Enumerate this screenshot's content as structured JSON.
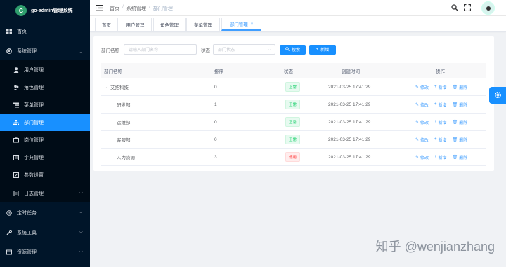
{
  "app": {
    "title": "go-admin管理系统",
    "logo_letter": "G"
  },
  "sidebar": {
    "items": [
      {
        "label": "首页",
        "icon": "dashboard-icon",
        "level": "top"
      },
      {
        "label": "系统管理",
        "icon": "setting-icon",
        "level": "top",
        "expanded": true
      },
      {
        "label": "用户管理",
        "icon": "user-icon",
        "level": "sub"
      },
      {
        "label": "角色管理",
        "icon": "peoples-icon",
        "level": "sub"
      },
      {
        "label": "菜单管理",
        "icon": "tree-table-icon",
        "level": "sub"
      },
      {
        "label": "部门管理",
        "icon": "tree-icon",
        "level": "sub",
        "active": true
      },
      {
        "label": "岗位管理",
        "icon": "post-icon",
        "level": "sub"
      },
      {
        "label": "字典管理",
        "icon": "dict-icon",
        "level": "sub"
      },
      {
        "label": "参数设置",
        "icon": "edit-icon",
        "level": "sub"
      },
      {
        "label": "日志管理",
        "icon": "log-icon",
        "level": "sub"
      },
      {
        "label": "定时任务",
        "icon": "job-icon",
        "level": "top"
      },
      {
        "label": "系统工具",
        "icon": "tool-icon",
        "level": "top"
      },
      {
        "label": "资源管理",
        "icon": "resource-icon",
        "level": "top"
      }
    ]
  },
  "header": {
    "breadcrumb": [
      "首页",
      "系统管理",
      "部门管理"
    ]
  },
  "tabs": [
    {
      "label": "首页"
    },
    {
      "label": "用户管理"
    },
    {
      "label": "角色管理"
    },
    {
      "label": "菜单管理"
    },
    {
      "label": "部门管理",
      "active": true,
      "close": "×"
    }
  ],
  "search": {
    "dept_label": "部门名称",
    "dept_placeholder": "请输入部门名称",
    "status_label": "状态",
    "status_placeholder": "部门状态",
    "search_button": "搜索",
    "add_button": "新增"
  },
  "table": {
    "columns": [
      "部门名称",
      "排序",
      "状态",
      "创建时间",
      "操作"
    ],
    "rows": [
      {
        "name": "艾拓科技",
        "sort": "0",
        "status": "正常",
        "status_type": "ok",
        "created": "2021-03-25 17:41:29",
        "indent": 0,
        "expandable": true
      },
      {
        "name": "研发部",
        "sort": "1",
        "status": "正常",
        "status_type": "ok",
        "created": "2021-03-25 17:41:29",
        "indent": 1
      },
      {
        "name": "运维部",
        "sort": "0",
        "status": "正常",
        "status_type": "ok",
        "created": "2021-03-25 17:41:29",
        "indent": 1
      },
      {
        "name": "客服部",
        "sort": "0",
        "status": "正常",
        "status_type": "ok",
        "created": "2021-03-25 17:41:29",
        "indent": 1
      },
      {
        "name": "人力资源",
        "sort": "3",
        "status": "停用",
        "status_type": "off",
        "created": "2021-03-25 17:41:29",
        "indent": 1
      }
    ],
    "ops": {
      "edit": "修改",
      "add": "新增",
      "delete": "删除"
    }
  },
  "watermark": "知乎 @wenjianzhang",
  "colors": {
    "sidebar_bg": "#001529",
    "accent": "#1890ff",
    "success": "#13ce66",
    "danger": "#ff4949"
  }
}
